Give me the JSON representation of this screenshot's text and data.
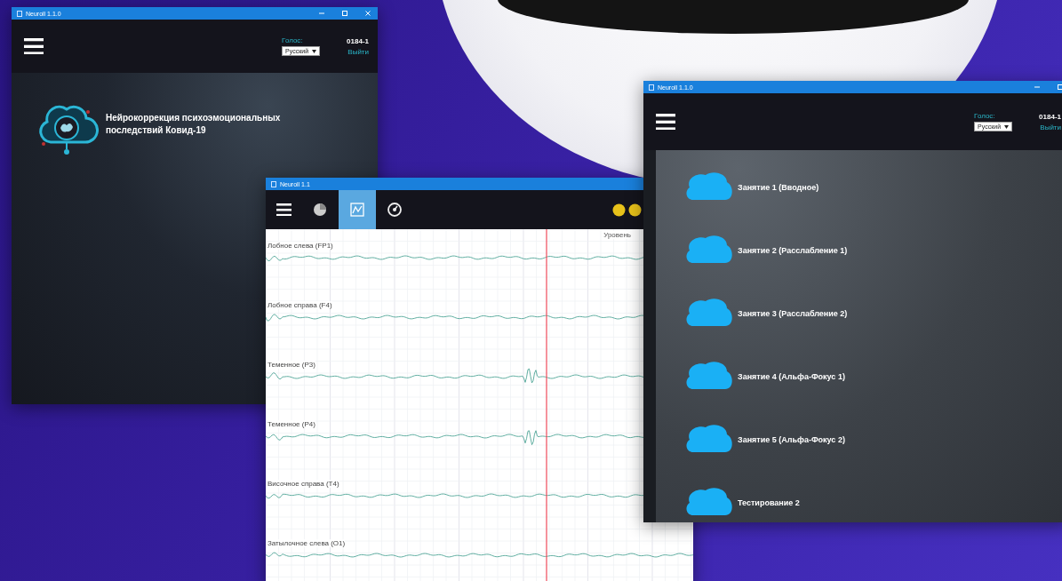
{
  "windows": [
    {
      "kind": "home",
      "title": "Neuroll 1.1.0",
      "voice_label": "Голос:",
      "language": "Русский",
      "user": "0184-1",
      "logout": "Выйти",
      "heading": "Нейрокоррекция психоэмоциональных последствий Ковид-19"
    },
    {
      "kind": "eeg",
      "title": "Neuroll 1.1",
      "tabs": [
        {
          "selected": false
        },
        {
          "selected": true
        },
        {
          "selected": false
        }
      ],
      "legend": "Уровень",
      "channels": [
        {
          "label": "Лобное слева (FP1)"
        },
        {
          "label": "Лобное справа (F4)"
        },
        {
          "label": "Теменное (P3)"
        },
        {
          "label": "Теменное (P4)"
        },
        {
          "label": "Височное справа (T4)"
        },
        {
          "label": "Затылочное слева (O1)"
        }
      ]
    },
    {
      "kind": "lessons",
      "title": "Neuroll 1.1.0",
      "voice_label": "Голос:",
      "language": "Русский",
      "user": "0184-1",
      "logout": "Выйти",
      "lessons": [
        {
          "label": "Занятие 1 (Вводное)"
        },
        {
          "label": "Занятие 2 (Расслабление 1)"
        },
        {
          "label": "Занятие 3 (Расслабление 2)"
        },
        {
          "label": "Занятие 4 (Альфа-Фокус 1)"
        },
        {
          "label": "Занятие 5 (Альфа-Фокус 2)"
        },
        {
          "label": "Тестирование 2"
        }
      ]
    }
  ]
}
